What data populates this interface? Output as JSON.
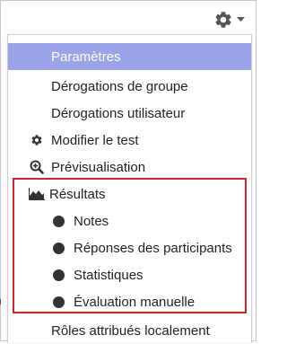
{
  "topbar": {
    "gear_icon": "gear-icon",
    "caret_icon": "caret-down-icon"
  },
  "menu": {
    "items": [
      {
        "label": "Paramètres",
        "active": true
      },
      {
        "label": "Dérogations de groupe"
      },
      {
        "label": "Dérogations utilisateur"
      },
      {
        "label": "Modifier le test",
        "icon": "gear-icon"
      },
      {
        "label": "Prévisualisation",
        "icon": "zoom-in-icon"
      },
      {
        "label": "Résultats",
        "icon": "area-chart-icon"
      },
      {
        "label": "Notes",
        "icon": "bullet-icon"
      },
      {
        "label": "Réponses des participants",
        "icon": "bullet-icon"
      },
      {
        "label": "Statistiques",
        "icon": "bullet-icon"
      },
      {
        "label": "Évaluation manuelle",
        "icon": "bullet-icon"
      },
      {
        "label": "Rôles attribués localement"
      }
    ]
  },
  "colors": {
    "active_background": "#9ba4e8",
    "active_text": "#ffffff",
    "highlight_border": "#d3222a",
    "icon": "#333333"
  }
}
